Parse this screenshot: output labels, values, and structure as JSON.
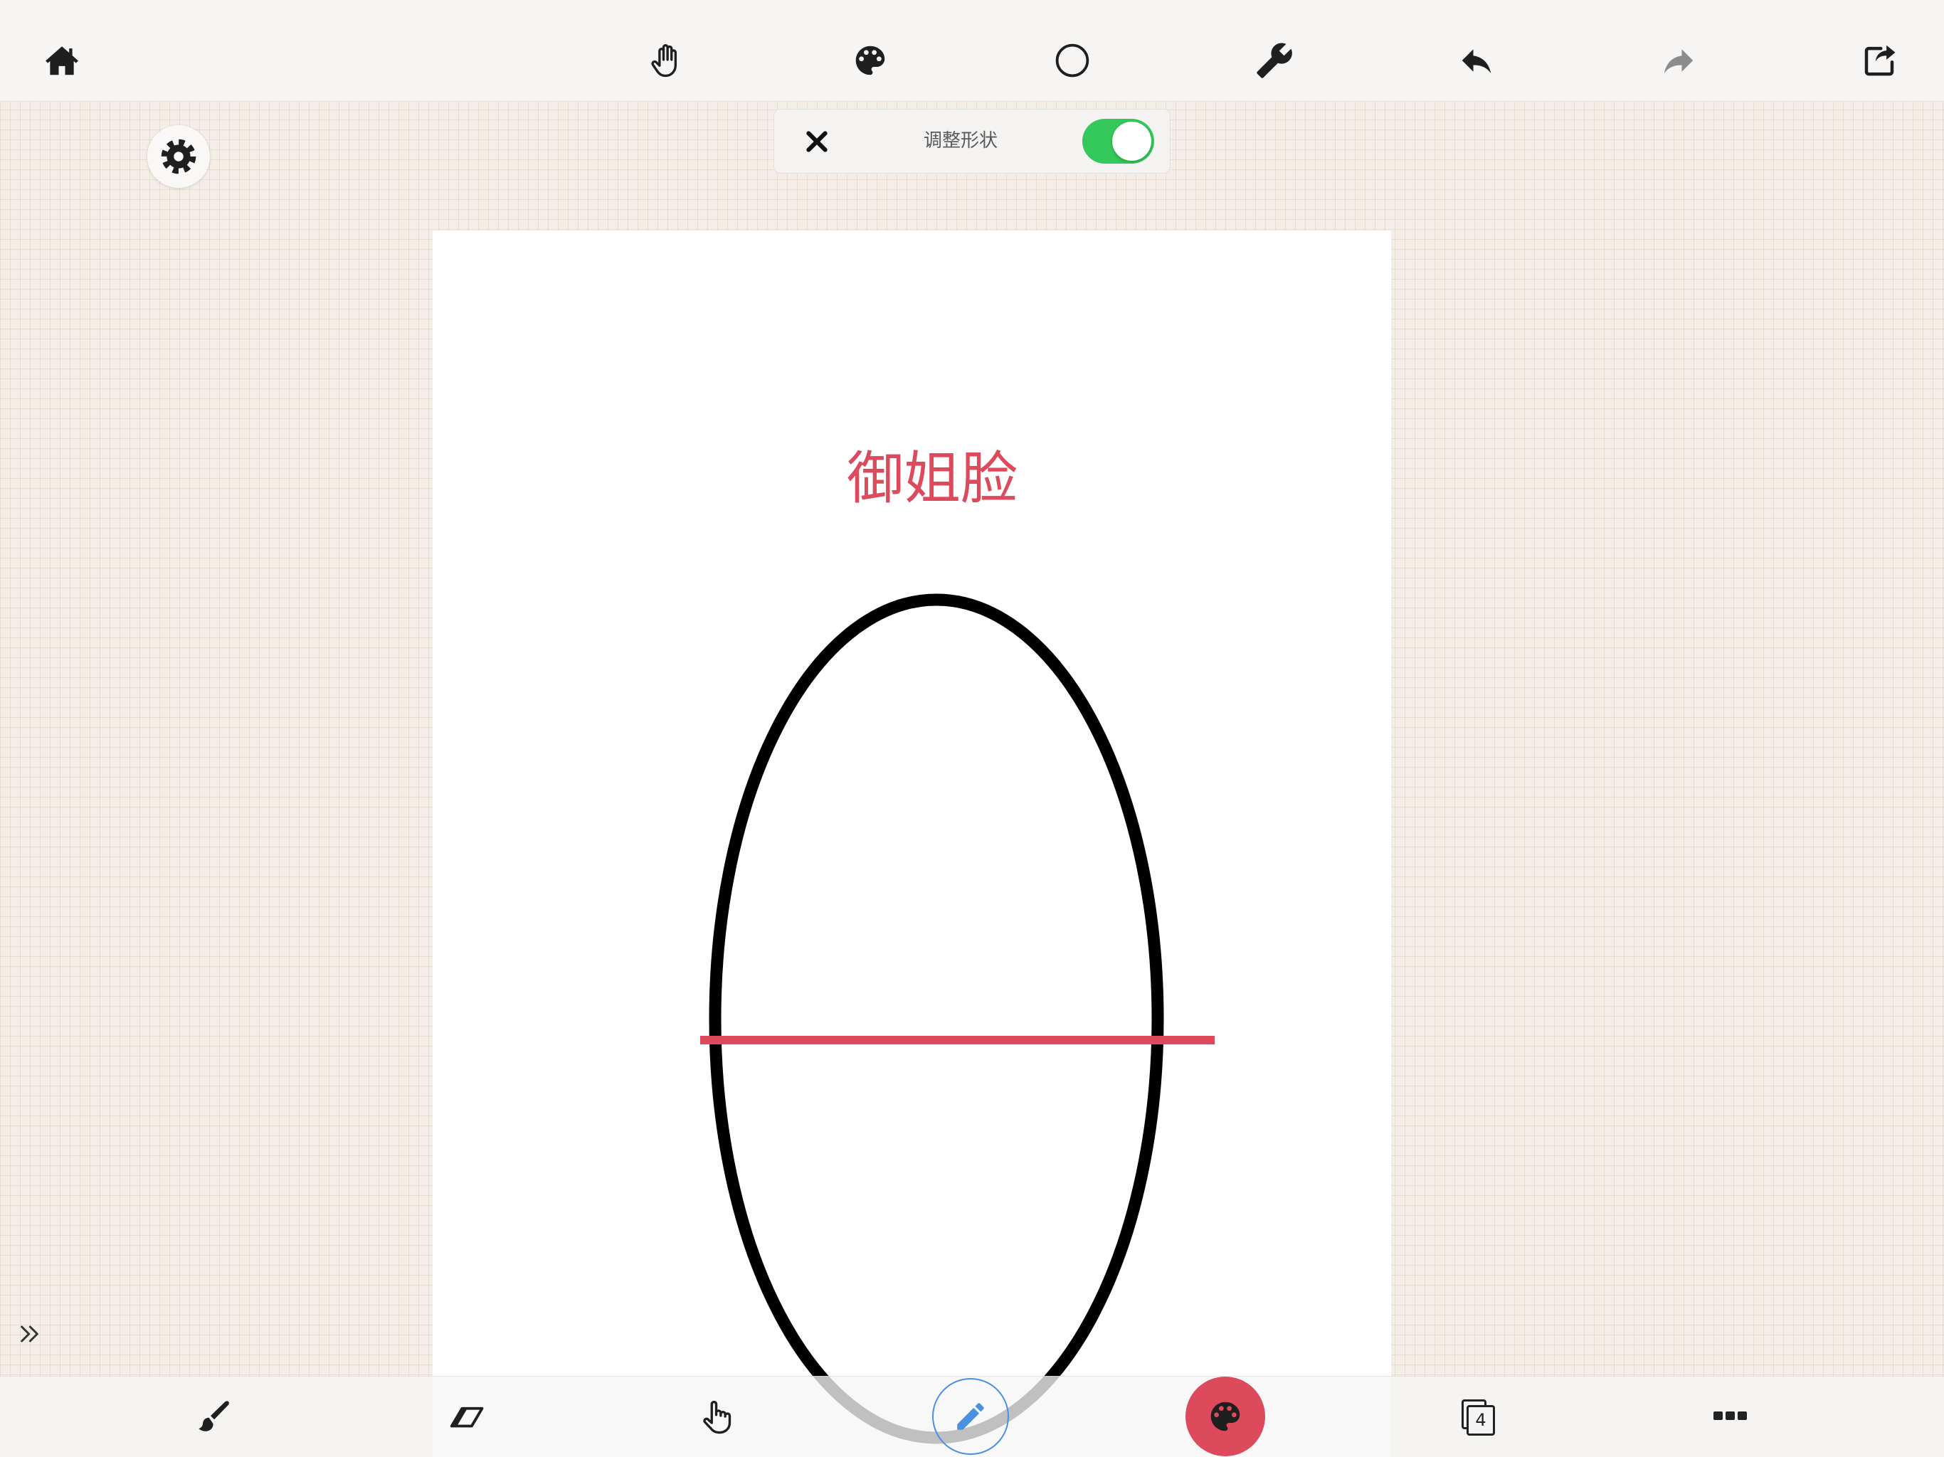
{
  "top_toolbar": {
    "icons": [
      "home-icon",
      "hand-icon",
      "palette-icon",
      "circle-shape-icon",
      "wrench-icon",
      "undo-icon",
      "redo-icon",
      "share-icon"
    ]
  },
  "settings": {
    "icon": "gear-icon"
  },
  "shape_panel": {
    "close_icon": "close-icon",
    "label": "调整形状",
    "toggle_on": true
  },
  "canvas": {
    "text": "御姐脸"
  },
  "side_toggle": {
    "icon": "double-chevron-right-icon"
  },
  "bottom_toolbar": {
    "icons": [
      "brush-icon",
      "eraser-icon",
      "pointer-hand-icon",
      "pencil-icon",
      "palette-icon",
      "layers-icon",
      "more-icon"
    ],
    "layers_count": "4"
  },
  "colors": {
    "accent": "#dc4a5c",
    "toggle": "#34c759",
    "pencil": "#4a90e2",
    "ink": "#000000",
    "bar": "#f6f5f4"
  }
}
